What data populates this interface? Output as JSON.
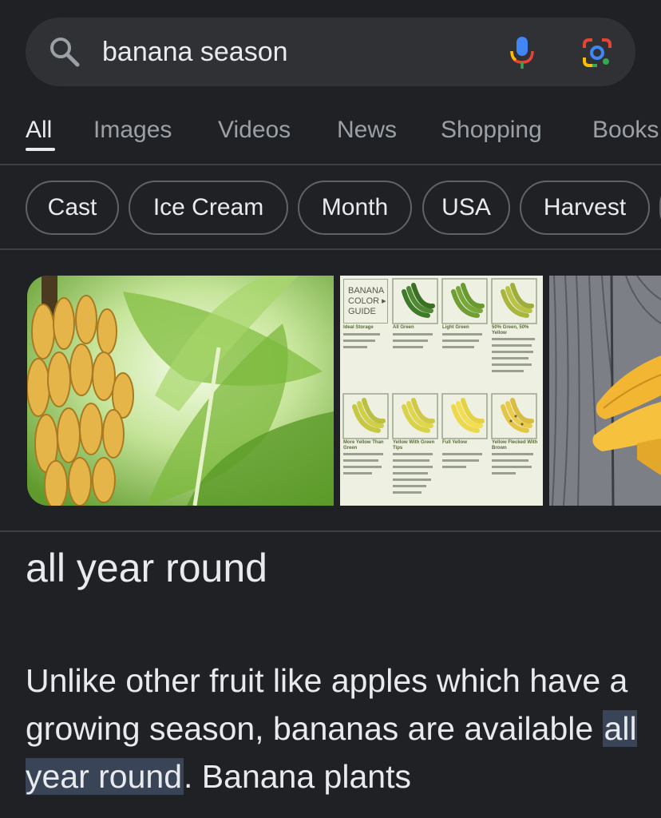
{
  "search": {
    "query": "banana season",
    "icons": [
      "search-icon",
      "mic-icon",
      "google-lens-icon"
    ]
  },
  "tabs": [
    {
      "label": "All",
      "active": true
    },
    {
      "label": "Images"
    },
    {
      "label": "Videos"
    },
    {
      "label": "News"
    },
    {
      "label": "Shopping"
    },
    {
      "label": "Books"
    }
  ],
  "chips": [
    "Cast",
    "Ice Cream",
    "Month",
    "USA",
    "Harvest"
  ],
  "guide": {
    "title_lines": [
      "BANANA",
      "COLOR ▸",
      "GUIDE"
    ],
    "row1_labels": [
      "Ideal Storage",
      "All Green",
      "Light Green",
      "50% Green, 50% Yellow"
    ],
    "row2_labels": [
      "More Yellow Than Green",
      "Yellow With Green Tips",
      "Full Yellow",
      "Yellow Flecked With Brown"
    ]
  },
  "result": {
    "answer": "all year round",
    "snippet_before": "Unlike other fruit like apples which have a growing season, bananas are available ",
    "snippet_highlight": "all year round",
    "snippet_after": ". Banana plants"
  },
  "colors": {
    "background": "#202124",
    "surface": "#303134",
    "highlight": "#394457",
    "muted_text": "#9aa0a6"
  }
}
